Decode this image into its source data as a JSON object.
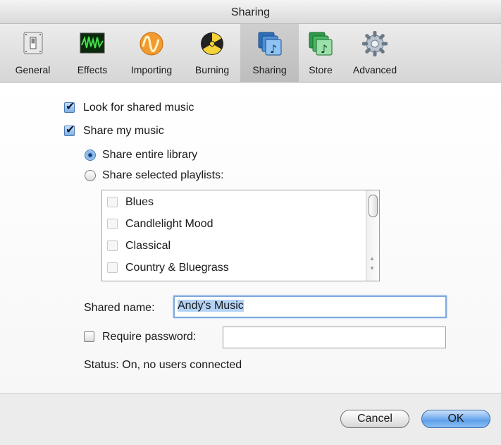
{
  "window": {
    "title": "Sharing"
  },
  "toolbar": {
    "items": [
      {
        "label": "General",
        "icon": "switch-icon"
      },
      {
        "label": "Effects",
        "icon": "waveform-icon"
      },
      {
        "label": "Importing",
        "icon": "wave-circle-icon"
      },
      {
        "label": "Burning",
        "icon": "radiation-icon"
      },
      {
        "label": "Sharing",
        "icon": "shared-music-icon",
        "selected": true
      },
      {
        "label": "Store",
        "icon": "store-music-icon"
      },
      {
        "label": "Advanced",
        "icon": "gear-icon"
      }
    ]
  },
  "sharing": {
    "look_for_shared": {
      "label": "Look for shared music",
      "checked": true
    },
    "share_my_music": {
      "label": "Share my music",
      "checked": true
    },
    "share_entire": {
      "label": "Share entire library",
      "selected": true
    },
    "share_selected": {
      "label": "Share selected playlists:",
      "selected": false
    },
    "playlists": [
      {
        "label": "Blues",
        "checked": false
      },
      {
        "label": "Candlelight Mood",
        "checked": false
      },
      {
        "label": "Classical",
        "checked": false
      },
      {
        "label": "Country & Bluegrass",
        "checked": false
      }
    ],
    "shared_name": {
      "label": "Shared name:",
      "value": "Andy's Music"
    },
    "require_password": {
      "label": "Require password:",
      "checked": false,
      "value": ""
    },
    "status": "Status: On, no users connected"
  },
  "buttons": {
    "cancel": "Cancel",
    "ok": "OK"
  },
  "colors": {
    "accent": "#5fa0ea",
    "selection": "#b3d3f5"
  }
}
